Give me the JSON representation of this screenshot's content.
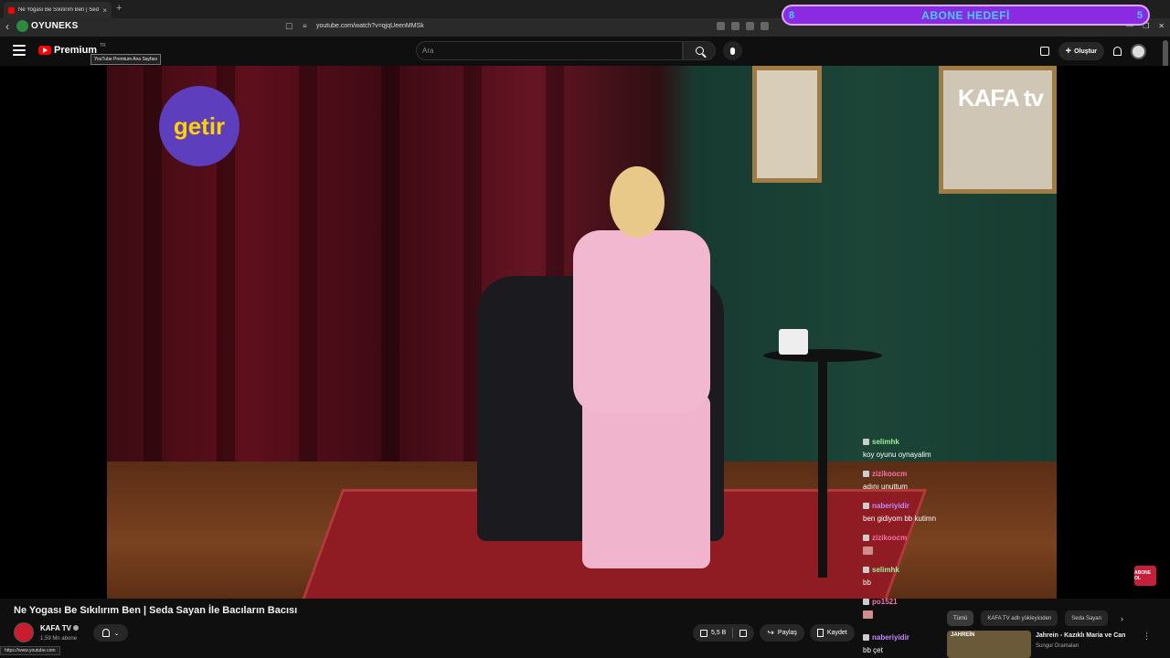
{
  "browser": {
    "tab_title": "Ne Yogası Be Sıkılırım Ben | Sed",
    "tab_close": "×",
    "new_tab": "+",
    "back": "‹",
    "brand": "OYUNEKS",
    "url": "youtube.com/watch?v=qjqUeenMMSk",
    "window_controls": [
      "—",
      "❐",
      "✕"
    ]
  },
  "stream_overlay": {
    "goal_left": "8",
    "goal_label": "ABONE HEDEFİ",
    "goal_right": "5"
  },
  "header": {
    "logo_text": "Premium",
    "region": "TR",
    "tooltip": "YouTube Premium Ana Sayfası",
    "search_placeholder": "Ara",
    "create_label": "Oluştur",
    "create_plus": "+"
  },
  "video_overlay": {
    "sponsor_logo": "getir",
    "channel_watermark": "KAFA tv"
  },
  "chat": [
    {
      "user": "selimhk",
      "text": "koy oyunu oynayalim",
      "color": "#9fef9b"
    },
    {
      "user": "zizikoocm",
      "text": "adını unuttum",
      "color": "#ff6fae"
    },
    {
      "user": "naberiyidir",
      "text": "ben gidiyom bb kutimn",
      "color": "#c18cff"
    },
    {
      "user": "zizikoocm",
      "text": "",
      "color": "#ff6fae"
    },
    {
      "user": "selimhk",
      "text": "bb",
      "color": "#9fef9b"
    },
    {
      "user": "po1521",
      "text": "",
      "color": "#ff6fae"
    },
    {
      "user": "naberiyidir",
      "text": "bb çet",
      "color": "#c18cff"
    }
  ],
  "video": {
    "title": "Ne Yogası Be Sıkılırım Ben | Seda Sayan İle Bacıların Bacısı",
    "channel": "KAFA TV",
    "subscribers": "1,59 Mn abone",
    "subscribe_chevron": "⌄",
    "likes": "5,5 B",
    "share_label": "Paylaş",
    "save_label": "Kaydet"
  },
  "recommendations": {
    "chips": [
      "Tümü",
      "KAFA TV adlı yükleyiciden",
      "Seda Sayan"
    ],
    "next_arrow": "›",
    "item": {
      "title": "Jahrein - Kazıklı Maria ve Can",
      "channel": "Sungur Dramaları",
      "thumb_text": "JAHREİN",
      "more": "⋮"
    }
  },
  "status_url": "https://www.youtube.com",
  "subscribe_mini": "ABONE OL",
  "colors": {
    "youtube_red": "#ff0000",
    "goal_purple": "#8a2be2",
    "goal_text": "#3fd0ff",
    "getir_purple": "#5d3ebc",
    "getir_yellow": "#ffd300"
  }
}
